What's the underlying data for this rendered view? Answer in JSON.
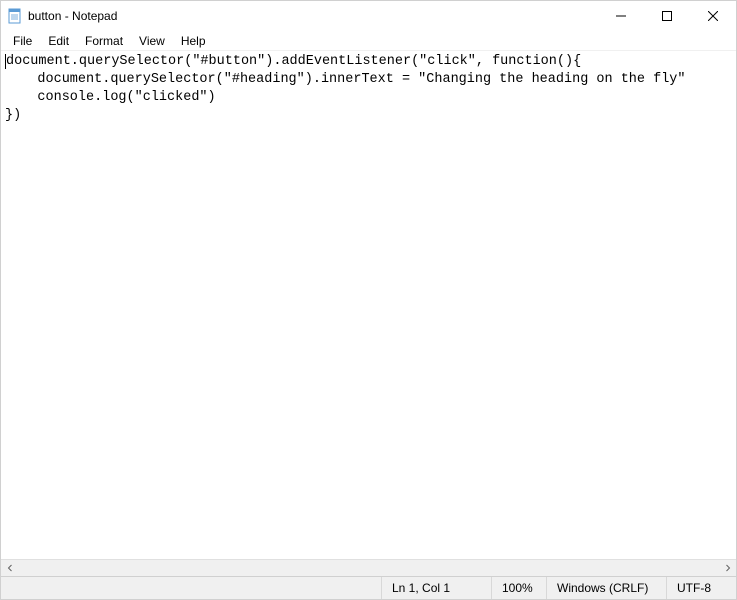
{
  "window": {
    "title": "button - Notepad"
  },
  "menu": {
    "file": "File",
    "edit": "Edit",
    "format": "Format",
    "view": "View",
    "help": "Help"
  },
  "editor": {
    "content": "document.querySelector(\"#button\").addEventListener(\"click\", function(){\n    document.querySelector(\"#heading\").innerText = \"Changing the heading on the fly\"\n    console.log(\"clicked\")\n})"
  },
  "statusbar": {
    "position": "Ln 1, Col 1",
    "zoom": "100%",
    "lineending": "Windows (CRLF)",
    "encoding": "UTF-8"
  }
}
